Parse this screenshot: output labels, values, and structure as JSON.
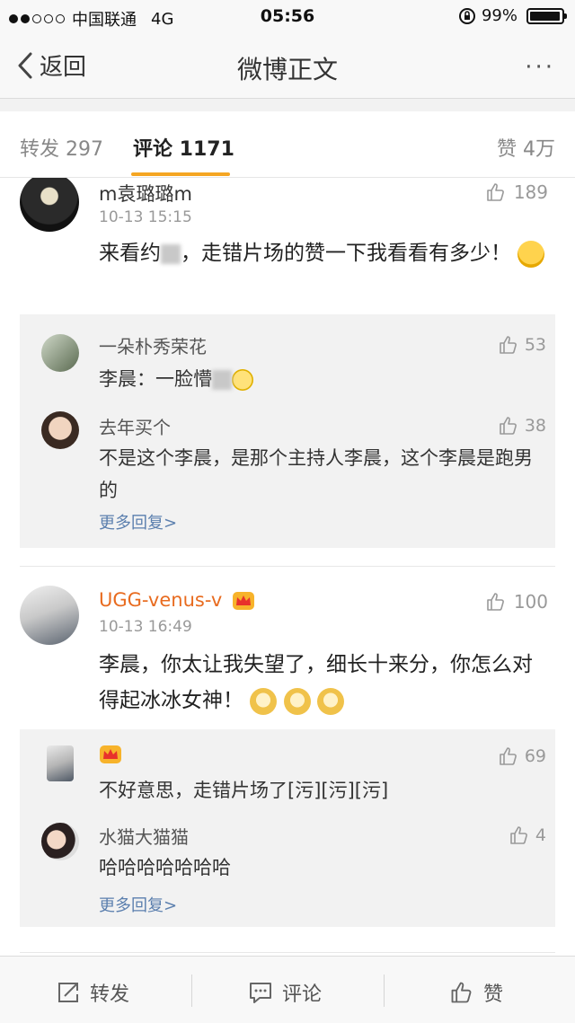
{
  "status_bar": {
    "carrier": "中国联通",
    "network": "4G",
    "time": "05:56",
    "battery": "99%"
  },
  "nav": {
    "back_label": "返回",
    "title": "微博正文",
    "more": "···"
  },
  "tabs": [
    {
      "label": "转发 297"
    },
    {
      "label": "评论 1171"
    },
    {
      "label": "赞 4万"
    }
  ],
  "comments": [
    {
      "name": "m袁璐璐m",
      "time": "10-13 15:15",
      "likes": "189",
      "text_a": "来看约",
      "text_b": "，走错片场的赞一下我看看有多少！",
      "replies": [
        {
          "name": "一朵朴秀荣花",
          "text_a": "李晨：一脸懵",
          "text_b": "",
          "likes": "53"
        },
        {
          "name": "去年买个",
          "text_a": "不是这个李晨，是那个主持人李晨，这个李晨是跑男的",
          "text_b": "",
          "likes": "38"
        }
      ],
      "more_replies": "更多回复>"
    },
    {
      "name": "UGG-venus-v",
      "time": "10-13 16:49",
      "likes": "100",
      "text_a": "李晨，你太让我失望了，细长十来分，你怎么对得起冰冰女神！",
      "text_b": "",
      "replies": [
        {
          "name": "",
          "text_a": "不好意思，走错片场了[污][污][污]",
          "text_b": "",
          "likes": "69"
        },
        {
          "name": "水猫大猫猫",
          "text_a": "哈哈哈哈哈哈哈",
          "text_b": "",
          "likes": "4"
        }
      ],
      "more_replies": "更多回复>"
    }
  ],
  "bottom_bar": {
    "repost": "转发",
    "comment": "评论",
    "like": "赞"
  },
  "colors": {
    "accent": "#f5a623",
    "vip_name": "#e86b1f",
    "link": "#5b7fae"
  }
}
